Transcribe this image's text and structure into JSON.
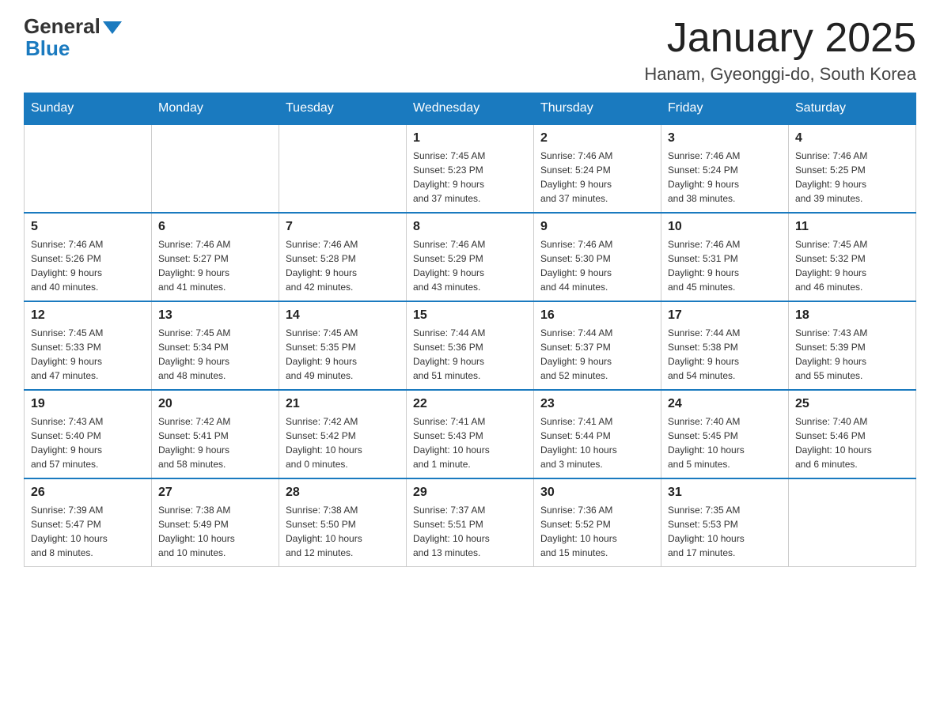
{
  "header": {
    "logo_general": "General",
    "logo_blue": "Blue",
    "title": "January 2025",
    "subtitle": "Hanam, Gyeonggi-do, South Korea"
  },
  "days_of_week": [
    "Sunday",
    "Monday",
    "Tuesday",
    "Wednesday",
    "Thursday",
    "Friday",
    "Saturday"
  ],
  "weeks": [
    [
      {
        "day": "",
        "info": ""
      },
      {
        "day": "",
        "info": ""
      },
      {
        "day": "",
        "info": ""
      },
      {
        "day": "1",
        "info": "Sunrise: 7:45 AM\nSunset: 5:23 PM\nDaylight: 9 hours\nand 37 minutes."
      },
      {
        "day": "2",
        "info": "Sunrise: 7:46 AM\nSunset: 5:24 PM\nDaylight: 9 hours\nand 37 minutes."
      },
      {
        "day": "3",
        "info": "Sunrise: 7:46 AM\nSunset: 5:24 PM\nDaylight: 9 hours\nand 38 minutes."
      },
      {
        "day": "4",
        "info": "Sunrise: 7:46 AM\nSunset: 5:25 PM\nDaylight: 9 hours\nand 39 minutes."
      }
    ],
    [
      {
        "day": "5",
        "info": "Sunrise: 7:46 AM\nSunset: 5:26 PM\nDaylight: 9 hours\nand 40 minutes."
      },
      {
        "day": "6",
        "info": "Sunrise: 7:46 AM\nSunset: 5:27 PM\nDaylight: 9 hours\nand 41 minutes."
      },
      {
        "day": "7",
        "info": "Sunrise: 7:46 AM\nSunset: 5:28 PM\nDaylight: 9 hours\nand 42 minutes."
      },
      {
        "day": "8",
        "info": "Sunrise: 7:46 AM\nSunset: 5:29 PM\nDaylight: 9 hours\nand 43 minutes."
      },
      {
        "day": "9",
        "info": "Sunrise: 7:46 AM\nSunset: 5:30 PM\nDaylight: 9 hours\nand 44 minutes."
      },
      {
        "day": "10",
        "info": "Sunrise: 7:46 AM\nSunset: 5:31 PM\nDaylight: 9 hours\nand 45 minutes."
      },
      {
        "day": "11",
        "info": "Sunrise: 7:45 AM\nSunset: 5:32 PM\nDaylight: 9 hours\nand 46 minutes."
      }
    ],
    [
      {
        "day": "12",
        "info": "Sunrise: 7:45 AM\nSunset: 5:33 PM\nDaylight: 9 hours\nand 47 minutes."
      },
      {
        "day": "13",
        "info": "Sunrise: 7:45 AM\nSunset: 5:34 PM\nDaylight: 9 hours\nand 48 minutes."
      },
      {
        "day": "14",
        "info": "Sunrise: 7:45 AM\nSunset: 5:35 PM\nDaylight: 9 hours\nand 49 minutes."
      },
      {
        "day": "15",
        "info": "Sunrise: 7:44 AM\nSunset: 5:36 PM\nDaylight: 9 hours\nand 51 minutes."
      },
      {
        "day": "16",
        "info": "Sunrise: 7:44 AM\nSunset: 5:37 PM\nDaylight: 9 hours\nand 52 minutes."
      },
      {
        "day": "17",
        "info": "Sunrise: 7:44 AM\nSunset: 5:38 PM\nDaylight: 9 hours\nand 54 minutes."
      },
      {
        "day": "18",
        "info": "Sunrise: 7:43 AM\nSunset: 5:39 PM\nDaylight: 9 hours\nand 55 minutes."
      }
    ],
    [
      {
        "day": "19",
        "info": "Sunrise: 7:43 AM\nSunset: 5:40 PM\nDaylight: 9 hours\nand 57 minutes."
      },
      {
        "day": "20",
        "info": "Sunrise: 7:42 AM\nSunset: 5:41 PM\nDaylight: 9 hours\nand 58 minutes."
      },
      {
        "day": "21",
        "info": "Sunrise: 7:42 AM\nSunset: 5:42 PM\nDaylight: 10 hours\nand 0 minutes."
      },
      {
        "day": "22",
        "info": "Sunrise: 7:41 AM\nSunset: 5:43 PM\nDaylight: 10 hours\nand 1 minute."
      },
      {
        "day": "23",
        "info": "Sunrise: 7:41 AM\nSunset: 5:44 PM\nDaylight: 10 hours\nand 3 minutes."
      },
      {
        "day": "24",
        "info": "Sunrise: 7:40 AM\nSunset: 5:45 PM\nDaylight: 10 hours\nand 5 minutes."
      },
      {
        "day": "25",
        "info": "Sunrise: 7:40 AM\nSunset: 5:46 PM\nDaylight: 10 hours\nand 6 minutes."
      }
    ],
    [
      {
        "day": "26",
        "info": "Sunrise: 7:39 AM\nSunset: 5:47 PM\nDaylight: 10 hours\nand 8 minutes."
      },
      {
        "day": "27",
        "info": "Sunrise: 7:38 AM\nSunset: 5:49 PM\nDaylight: 10 hours\nand 10 minutes."
      },
      {
        "day": "28",
        "info": "Sunrise: 7:38 AM\nSunset: 5:50 PM\nDaylight: 10 hours\nand 12 minutes."
      },
      {
        "day": "29",
        "info": "Sunrise: 7:37 AM\nSunset: 5:51 PM\nDaylight: 10 hours\nand 13 minutes."
      },
      {
        "day": "30",
        "info": "Sunrise: 7:36 AM\nSunset: 5:52 PM\nDaylight: 10 hours\nand 15 minutes."
      },
      {
        "day": "31",
        "info": "Sunrise: 7:35 AM\nSunset: 5:53 PM\nDaylight: 10 hours\nand 17 minutes."
      },
      {
        "day": "",
        "info": ""
      }
    ]
  ]
}
